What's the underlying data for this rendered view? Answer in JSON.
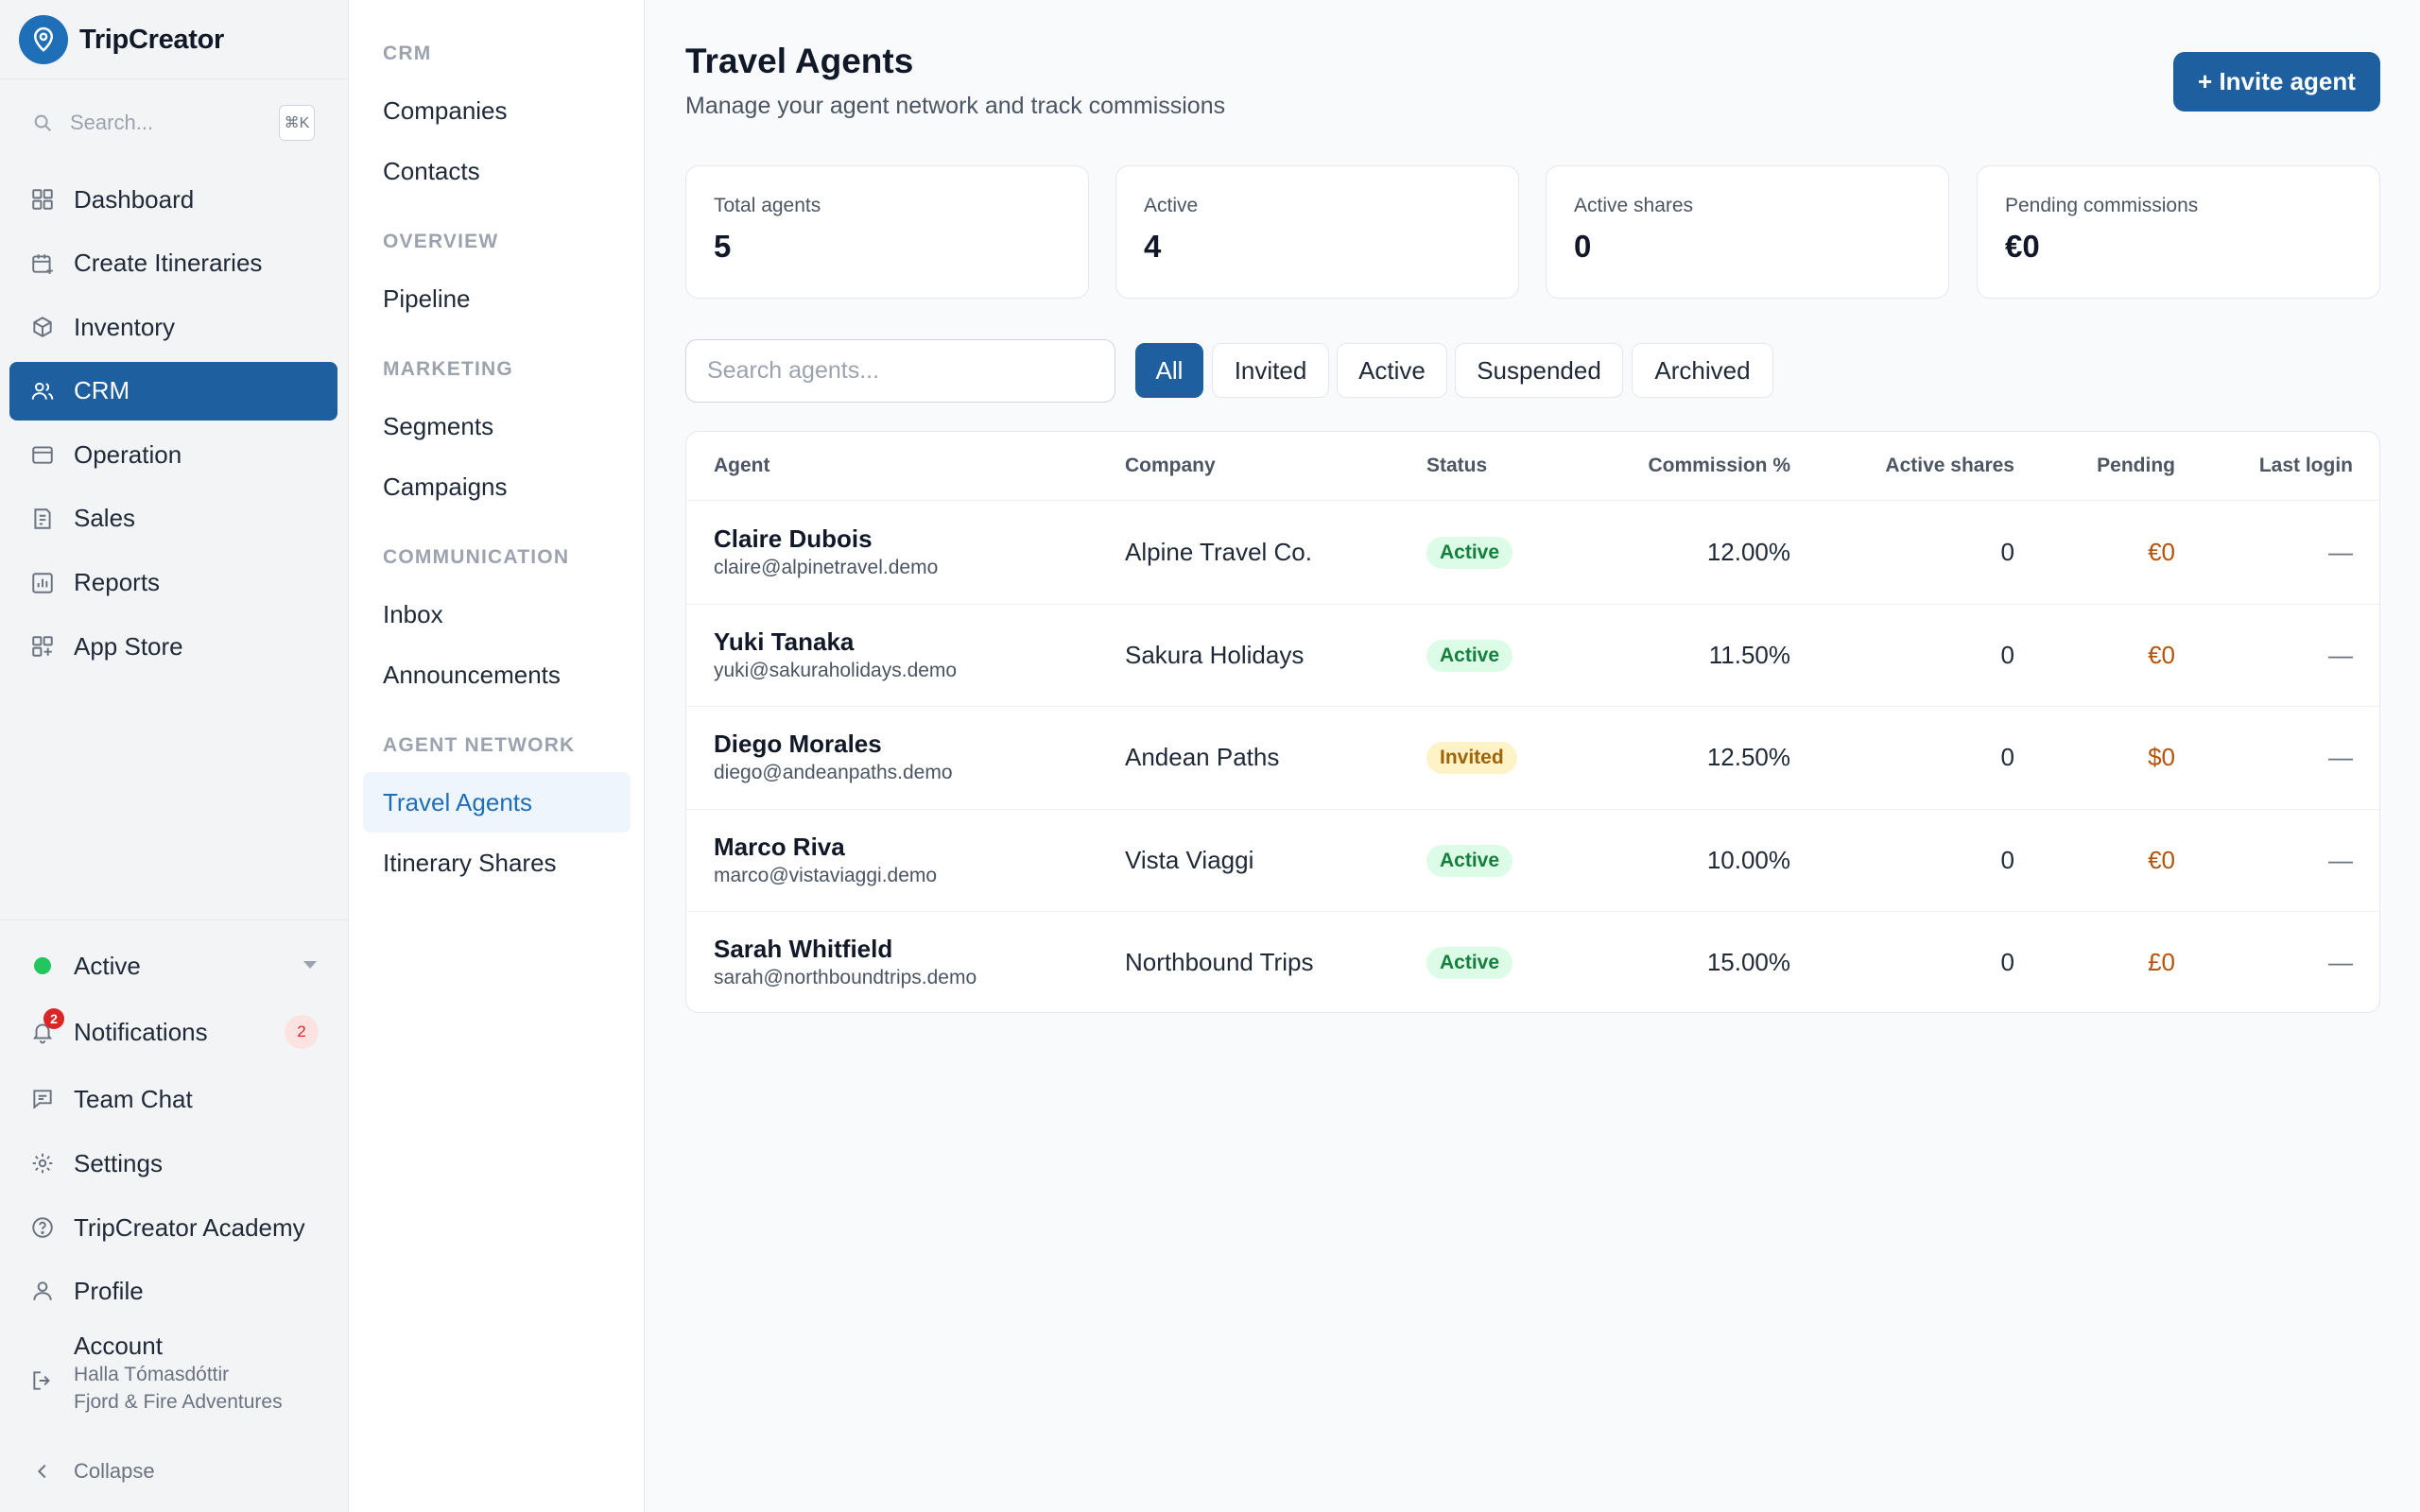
{
  "brand": {
    "name": "TripCreator"
  },
  "search": {
    "placeholder": "Search...",
    "shortcut": "⌘K"
  },
  "sidebar": {
    "items": [
      {
        "label": "Dashboard",
        "icon": "grid-icon"
      },
      {
        "label": "Create Itineraries",
        "icon": "calendar-plus-icon"
      },
      {
        "label": "Inventory",
        "icon": "box-icon"
      },
      {
        "label": "CRM",
        "icon": "users-icon",
        "active": true
      },
      {
        "label": "Operation",
        "icon": "briefcase-icon"
      },
      {
        "label": "Sales",
        "icon": "receipt-icon"
      },
      {
        "label": "Reports",
        "icon": "chart-icon"
      },
      {
        "label": "App Store",
        "icon": "apps-plus-icon"
      }
    ],
    "bottom": {
      "status": "Active",
      "notifications": "Notifications",
      "notifications_count": "2",
      "team_chat": "Team Chat",
      "settings": "Settings",
      "academy": "TripCreator Academy",
      "profile": "Profile",
      "account": "Account",
      "account_user": "Halla Tómasdóttir",
      "account_company": "Fjord & Fire Adventures",
      "collapse": "Collapse"
    }
  },
  "subnav": {
    "sections": [
      {
        "title": "CRM",
        "items": [
          "Companies",
          "Contacts"
        ]
      },
      {
        "title": "OVERVIEW",
        "items": [
          "Pipeline"
        ]
      },
      {
        "title": "MARKETING",
        "items": [
          "Segments",
          "Campaigns"
        ]
      },
      {
        "title": "COMMUNICATION",
        "items": [
          "Inbox",
          "Announcements"
        ]
      },
      {
        "title": "AGENT NETWORK",
        "items": [
          "Travel Agents",
          "Itinerary Shares"
        ]
      }
    ],
    "active": "Travel Agents"
  },
  "header": {
    "title": "Travel Agents",
    "subtitle": "Manage your agent network and track commissions",
    "invite_label": "+ Invite agent"
  },
  "stats": [
    {
      "label": "Total agents",
      "value": "5"
    },
    {
      "label": "Active",
      "value": "4"
    },
    {
      "label": "Active shares",
      "value": "0"
    },
    {
      "label": "Pending commissions",
      "value": "€0"
    }
  ],
  "filters": {
    "search_placeholder": "Search agents...",
    "tabs": [
      "All",
      "Invited",
      "Active",
      "Suspended",
      "Archived"
    ],
    "active_tab": "All"
  },
  "table": {
    "columns": [
      "Agent",
      "Company",
      "Status",
      "Commission %",
      "Active shares",
      "Pending",
      "Last login"
    ],
    "rows": [
      {
        "name": "Claire Dubois",
        "email": "claire@alpinetravel.demo",
        "company": "Alpine Travel Co.",
        "status": "Active",
        "commission": "12.00%",
        "shares": "0",
        "pending": "€0",
        "last_login": "—"
      },
      {
        "name": "Yuki Tanaka",
        "email": "yuki@sakuraholidays.demo",
        "company": "Sakura Holidays",
        "status": "Active",
        "commission": "11.50%",
        "shares": "0",
        "pending": "€0",
        "last_login": "—"
      },
      {
        "name": "Diego Morales",
        "email": "diego@andeanpaths.demo",
        "company": "Andean Paths",
        "status": "Invited",
        "commission": "12.50%",
        "shares": "0",
        "pending": "$0",
        "last_login": "—"
      },
      {
        "name": "Marco Riva",
        "email": "marco@vistaviaggi.demo",
        "company": "Vista Viaggi",
        "status": "Active",
        "commission": "10.00%",
        "shares": "0",
        "pending": "€0",
        "last_login": "—"
      },
      {
        "name": "Sarah Whitfield",
        "email": "sarah@northboundtrips.demo",
        "company": "Northbound Trips",
        "status": "Active",
        "commission": "15.00%",
        "shares": "0",
        "pending": "£0",
        "last_login": "—"
      }
    ]
  },
  "colors": {
    "primary": "#1e5fa0",
    "brand": "#1e6fb8",
    "active_status": "#15803d",
    "invited_status": "#a16207",
    "pending": "#b45309"
  }
}
